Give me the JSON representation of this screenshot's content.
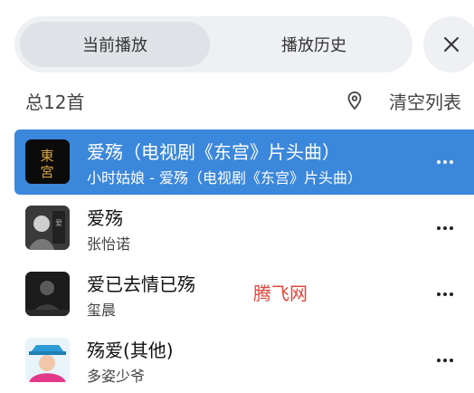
{
  "tabs": {
    "current": "当前播放",
    "history": "播放历史"
  },
  "header": {
    "total": "总12首",
    "clear": "清空列表"
  },
  "songs": [
    {
      "title": "爱殇（电视剧《东宫》片头曲）",
      "subtitle": "小时姑娘 - 爱殇（电视剧《东宫》片头曲）",
      "playing": true,
      "cover_label": "東宮"
    },
    {
      "title": "爱殇",
      "subtitle": "张怡诺",
      "playing": false
    },
    {
      "title": "爱已去情已殇",
      "subtitle": "玺晨",
      "playing": false
    },
    {
      "title": "殇爱(其他)",
      "subtitle": "多姿少爷",
      "playing": false
    }
  ],
  "watermark": "腾飞网",
  "colors": {
    "accent": "#3b87db",
    "tab_bg": "#eef0f3",
    "tab_active": "#dfe2e7",
    "watermark": "#e0463b"
  },
  "icons": {
    "close": "close-icon",
    "locate": "location-pin-icon",
    "more": "more-icon"
  }
}
